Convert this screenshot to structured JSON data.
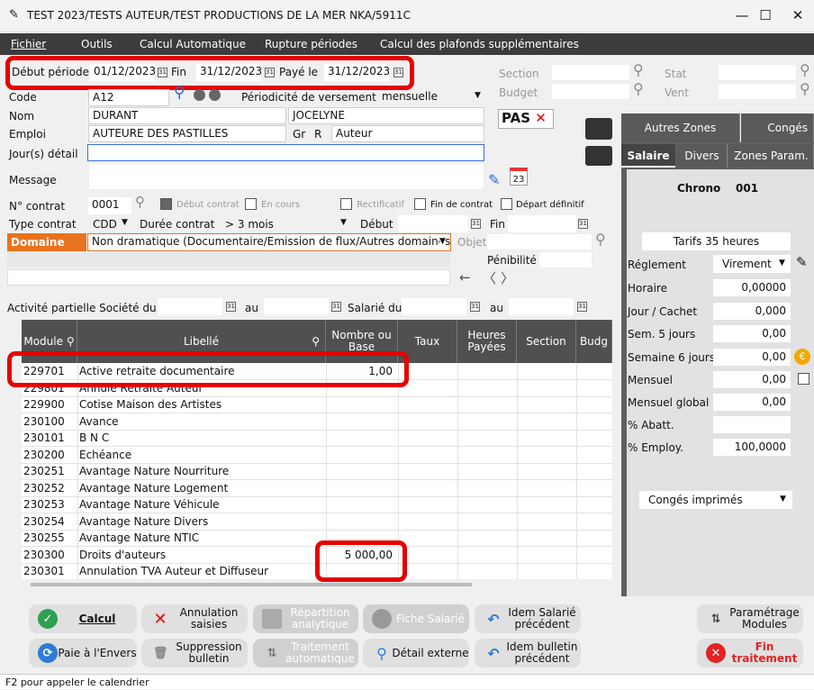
{
  "window": {
    "title": "TEST 2023/TESTS AUTEUR/TEST PRODUCTIONS DE LA MER NKA/5911C",
    "minimize": "—",
    "maximize": "☐",
    "close": "✕"
  },
  "menu": [
    "Fichier",
    "Outils",
    "Calcul Automatique",
    "Rupture périodes",
    "Calcul des plafonds supplémentaires"
  ],
  "period": {
    "debut_label": "Début période",
    "debut": "01/12/2023",
    "fin_label": "Fin",
    "fin": "31/12/2023",
    "paye_label": "Payé le",
    "paye": "31/12/2023",
    "cal_glyph": "31"
  },
  "filters": {
    "section": "Section",
    "budget": "Budget",
    "stat": "Stat",
    "vent": "Vent"
  },
  "employee": {
    "code_label": "Code",
    "code": "A12",
    "periodicite_label": "Périodicité de versement",
    "periodicite": "mensuelle",
    "nom_label": "Nom",
    "nom": "DURANT",
    "prenom": "JOCELYNE",
    "emploi_label": "Emploi",
    "emploi": "AUTEURE DES PASTILLES",
    "gr_label": "Gr",
    "gr": "R",
    "gr_value": "Auteur",
    "jours_label": "Jour(s) détail",
    "message_label": "Message",
    "pas": "PAS",
    "date_badge": "23"
  },
  "contract": {
    "numero_label": "N° contrat",
    "numero": "0001",
    "debut_contrat": "Début contrat",
    "en_cours": "En cours",
    "rectificatif": "Rectificatif",
    "fin_contrat": "Fin de contrat",
    "depart": "Départ définitif",
    "type_label": "Type contrat",
    "type": "CDD",
    "duree_label": "Durée contrat",
    "duree": "> 3 mois",
    "debut_label": "Début",
    "fin_label": "Fin",
    "domaine_label": "Domaine",
    "domaine": "Non dramatique (Documentaire/Emission de flux/Autres domaines",
    "objet_label": "Objet",
    "penibilite_label": "Pénibilité"
  },
  "activite": {
    "label": "Activité partielle Société du",
    "au": "au",
    "salarie_label": "Salarié du",
    "au2": "au"
  },
  "grid": {
    "headers": [
      "Module",
      "Libellé",
      "Nombre ou Base",
      "Taux",
      "Heures Payées",
      "Section",
      "Budg"
    ],
    "rows": [
      {
        "module": "229701",
        "libelle": "Active retraite documentaire",
        "nombre": "1,00"
      },
      {
        "module": "229801",
        "libelle": "Annule Retraite Auteur",
        "nombre": ""
      },
      {
        "module": "229900",
        "libelle": "Cotise Maison des Artistes",
        "nombre": ""
      },
      {
        "module": "230100",
        "libelle": "Avance",
        "nombre": ""
      },
      {
        "module": "230101",
        "libelle": "B N C",
        "nombre": ""
      },
      {
        "module": "230200",
        "libelle": "Echéance",
        "nombre": ""
      },
      {
        "module": "230251",
        "libelle": "Avantage Nature Nourriture",
        "nombre": ""
      },
      {
        "module": "230252",
        "libelle": "Avantage Nature Logement",
        "nombre": ""
      },
      {
        "module": "230253",
        "libelle": "Avantage Nature Véhicule",
        "nombre": ""
      },
      {
        "module": "230254",
        "libelle": "Avantage Nature Divers",
        "nombre": ""
      },
      {
        "module": "230255",
        "libelle": "Avantage Nature NTIC",
        "nombre": ""
      },
      {
        "module": "230300",
        "libelle": "Droits d'auteurs",
        "nombre": "5 000,00"
      },
      {
        "module": "230301",
        "libelle": "Annulation TVA Auteur et Diffuseur",
        "nombre": ""
      }
    ]
  },
  "right": {
    "autres_zones": "Autres Zones",
    "conges": "Congés",
    "tabs": [
      "Salaire",
      "Divers",
      "Zones Param."
    ],
    "chrono_label": "Chrono",
    "chrono": "001",
    "tarifs": "Tarifs 35 heures",
    "reglement_label": "Réglement",
    "reglement": "Virement",
    "fields": [
      {
        "label": "Horaire",
        "value": "0,00000"
      },
      {
        "label": "Jour / Cachet",
        "value": "0,000"
      },
      {
        "label": "Sem. 5 jours",
        "value": "0,00"
      },
      {
        "label": "Semaine 6 jours",
        "value": "0,00"
      },
      {
        "label": "Mensuel",
        "value": "0,00"
      },
      {
        "label": "Mensuel global",
        "value": "0,00"
      },
      {
        "label": "% Abatt.",
        "value": ""
      },
      {
        "label": "% Employ.",
        "value": "100,0000"
      }
    ],
    "conges_imprimes": "Congés imprimés"
  },
  "buttons": {
    "calcul": "Calcul",
    "annulation": "Annulation saisies",
    "repartition": "Répartition analytique",
    "fiche": "Fiche Salarié",
    "idem_salarie": "Idem Salarié précédent",
    "parametrage": "Paramétrage Modules",
    "paie_envers": "Paie à l'Envers",
    "suppression": "Suppression bulletin",
    "traitement": "Traitement automatique",
    "detail": "Détail externe",
    "idem_bulletin": "Idem bulletin précédent",
    "fin": "Fin traitement"
  },
  "status": "F2 pour appeler le calendrier"
}
